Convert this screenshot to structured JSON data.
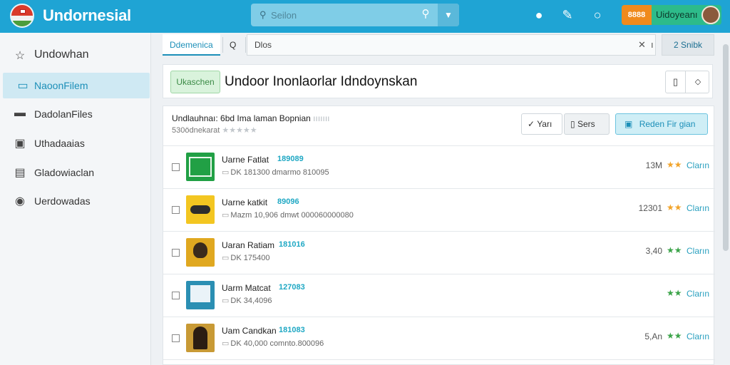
{
  "app": {
    "title": "Undornesial",
    "search_placeholder": "Seilon",
    "user_badge": "8888",
    "user_name": "Uidoyeanı"
  },
  "colors": {
    "header": "#1fa4d4",
    "accent": "#1c8fb8",
    "user_chip": "#2dbb8a",
    "badge": "#f08a1c"
  },
  "header_icons": [
    "bulb-icon",
    "pen-icon",
    "refresh-icon"
  ],
  "sidebar": {
    "items": [
      {
        "label": "Undowhan",
        "icon": "star-icon"
      },
      {
        "label": "NaoonFilem",
        "icon": "folder-icon",
        "active": true
      },
      {
        "label": "DadolanFiles",
        "icon": "file-icon"
      },
      {
        "label": "Uthadaaias",
        "icon": "window-icon"
      },
      {
        "label": "Gladowiaclan",
        "icon": "document-icon"
      },
      {
        "label": "Uerdowadas",
        "icon": "pin-icon"
      }
    ]
  },
  "tabs": {
    "active": "Ddemenica",
    "search_glyph": "Q",
    "input_value": "Dlos",
    "action_label": "2 Snibk"
  },
  "page": {
    "chip": "Ukaschen",
    "title": "Undoor Inonlaorlar Idndoynskan"
  },
  "list": {
    "header_title": "Undlauhnaı: 6bd Ima laman Bopnian",
    "header_title_muted": "ııııııı",
    "header_sub": "530ödnekarat",
    "header_stars": "★★★★★",
    "buttons": {
      "view": "Yarı",
      "sort": "Sers",
      "primary": "Reden Fir gian"
    },
    "rows": [
      {
        "name": "Uarne Fatlat",
        "code": "189089",
        "meta": "DK 181300 dmarmo 810095",
        "size": "13M",
        "stars": "★★",
        "tag": "Cların"
      },
      {
        "name": "Uarne katkit",
        "code": "89096",
        "meta": "Mazm 10,906 dmwt 000060000080",
        "size": "12301",
        "stars": "★★",
        "tag": "Cların"
      },
      {
        "name": "Uaran Ratiam",
        "code": "181016",
        "meta": "DK 175400",
        "size": "3,40",
        "stars": "★★",
        "tag": "Cların"
      },
      {
        "name": "Uarm Matcat",
        "code": "127083",
        "meta": "DK 34,4096",
        "size": "",
        "stars": "★★",
        "tag": "Cların"
      },
      {
        "name": "Uam Candkan",
        "code": "181083",
        "meta": "DK 40,000 comnto.800096",
        "size": "5,An",
        "stars": "★★",
        "tag": "Cların"
      }
    ]
  }
}
